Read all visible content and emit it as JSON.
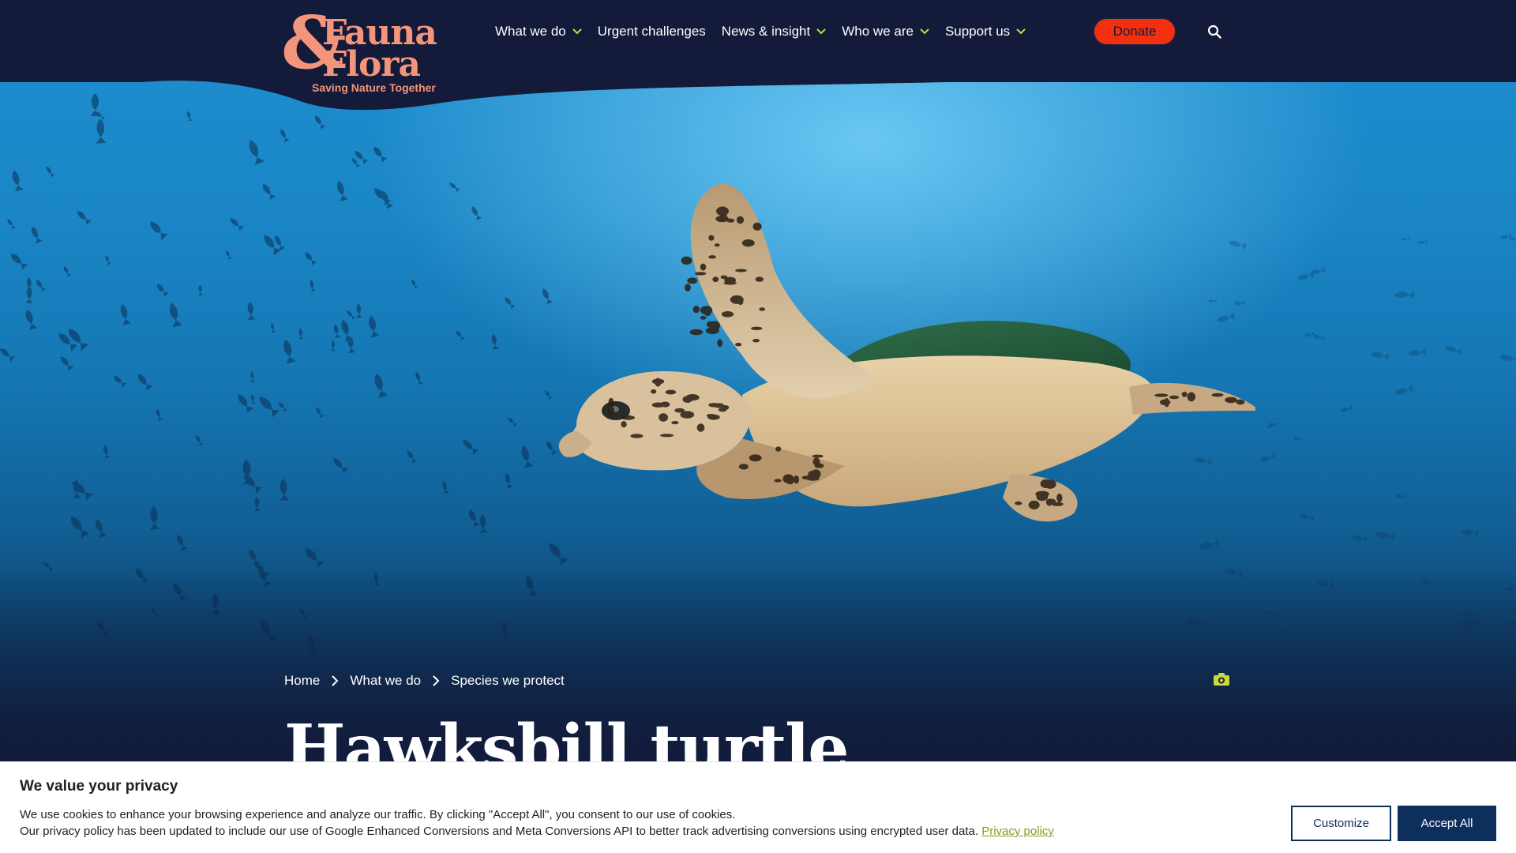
{
  "brand": {
    "logo_ampersand": "&",
    "logo_word1": "Fauna",
    "logo_word2": "Flora",
    "tagline": "Saving Nature Together",
    "color_logo": "#f2957a",
    "color_navy": "#131a3a"
  },
  "nav": {
    "items": [
      {
        "label": "What we do",
        "has_dropdown": true
      },
      {
        "label": "Urgent challenges",
        "has_dropdown": false
      },
      {
        "label": "News & insight",
        "has_dropdown": true
      },
      {
        "label": "Who we are",
        "has_dropdown": true
      },
      {
        "label": "Support us",
        "has_dropdown": true
      }
    ],
    "chevron_icon": "chevron-down-icon",
    "chevron_color": "#c8dc3c"
  },
  "header": {
    "donate_label": "Donate",
    "donate_color": "#f2300f",
    "search_icon": "search-icon"
  },
  "hero": {
    "image_subject": "hawksbill turtle swimming underwater",
    "camera_icon": "camera-icon",
    "camera_color": "#c8dc3c"
  },
  "breadcrumb": {
    "items": [
      "Home",
      "What we do",
      "Species we protect"
    ],
    "separator_icon": "chevron-right-icon"
  },
  "page": {
    "title": "Hawksbill turtle"
  },
  "cookie_banner": {
    "title": "We value your privacy",
    "line1": "We use cookies to enhance your browsing experience and analyze our traffic. By clicking \"Accept All\", you consent to our use of cookies.",
    "line2": "Our privacy policy has been updated to include our use of Google Enhanced Conversions and Meta Conversions API to better track advertising conversions using encrypted user data.",
    "link_label": "Privacy policy",
    "customize_label": "Customize",
    "accept_label": "Accept All",
    "button_color": "#0e2e5c"
  }
}
